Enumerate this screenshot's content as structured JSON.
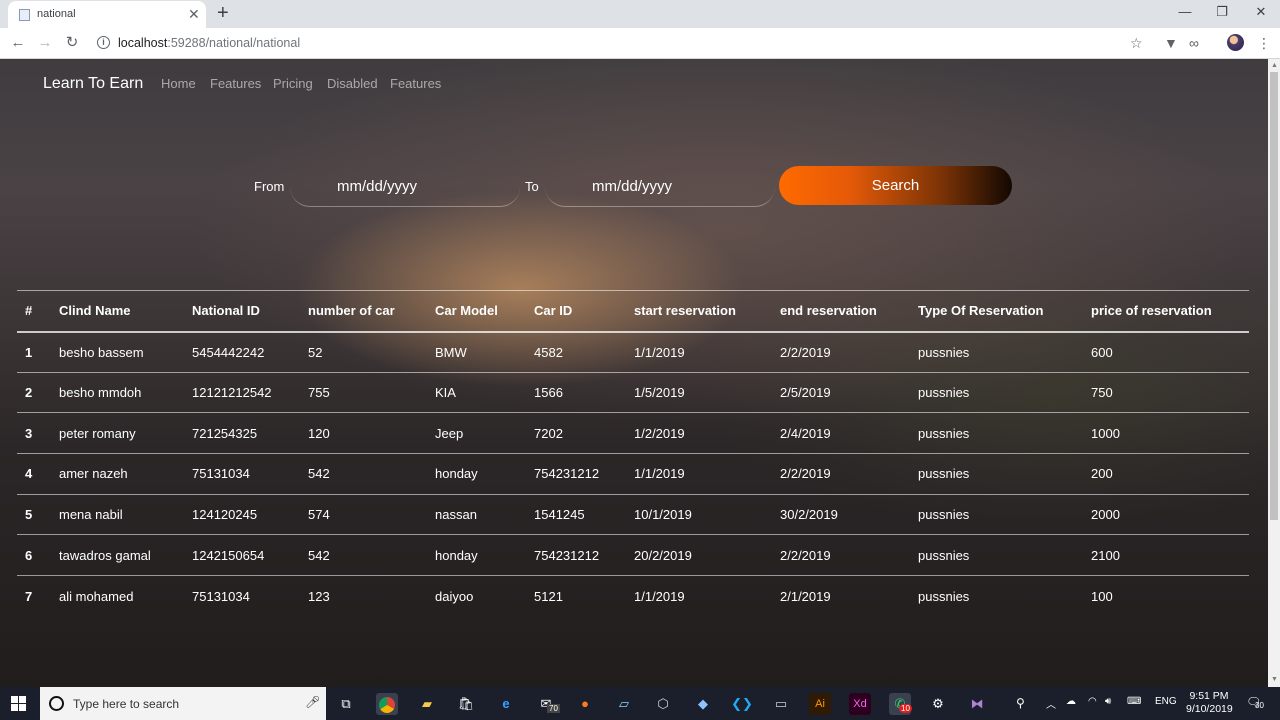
{
  "browser": {
    "tab_title": "national",
    "tab_close": "✕",
    "new_tab": "+",
    "url_host": "localhost",
    "url_rest": ":59288/national/national",
    "window_minimize": "—",
    "window_maximize": "❐",
    "window_close": "✕"
  },
  "navbar": {
    "brand": "Learn To Earn",
    "links": [
      "Home",
      "Features",
      "Pricing",
      "Disabled",
      "Features"
    ]
  },
  "search": {
    "from_label": "From",
    "from_value": "mm/dd/yyyy",
    "to_label": "To",
    "to_value": "mm/dd/yyyy",
    "button_label": "Search",
    "button_gradient": [
      "#ff6a00",
      "#120802"
    ]
  },
  "table": {
    "headers": [
      "#",
      "Clind Name",
      "National ID",
      "number of car",
      "Car Model",
      "Car ID",
      "start reservation",
      "end reservation",
      "Type Of Reservation",
      "price of reservation"
    ],
    "rows": [
      [
        "1",
        "besho bassem",
        "5454442242",
        "52",
        "BMW",
        "4582",
        "1/1/2019",
        "2/2/2019",
        "pussnies",
        "600"
      ],
      [
        "2",
        "besho mmdoh",
        "12121212542",
        "755",
        "KIA",
        "1566",
        "1/5/2019",
        "2/5/2019",
        "pussnies",
        "750"
      ],
      [
        "3",
        "peter romany",
        "721254325",
        "120",
        "Jeep",
        "7202",
        "1/2/2019",
        "2/4/2019",
        "pussnies",
        "1000"
      ],
      [
        "4",
        "amer nazeh",
        "75131034",
        "542",
        "honday",
        "754231212",
        "1/1/2019",
        "2/2/2019",
        "pussnies",
        "200"
      ],
      [
        "5",
        "mena nabil",
        "124120245",
        "574",
        "nassan",
        "1541245",
        "10/1/2019",
        "30/2/2019",
        "pussnies",
        "2000"
      ],
      [
        "6",
        "tawadros gamal",
        "1242150654",
        "542",
        "honday",
        "754231212",
        "20/2/2019",
        "2/2/2019",
        "pussnies",
        "2100"
      ],
      [
        "7",
        "ali mohamed",
        "75131034",
        "123",
        "daiyoo",
        "5121",
        "1/1/2019",
        "2/1/2019",
        "pussnies",
        "100"
      ]
    ]
  },
  "taskbar": {
    "search_placeholder": "Type here to search",
    "mail_badge": "70",
    "whatsapp_badge": "10",
    "language": "ENG",
    "time": "9:51 PM",
    "date": "9/10/2019",
    "notification_count": "30"
  }
}
